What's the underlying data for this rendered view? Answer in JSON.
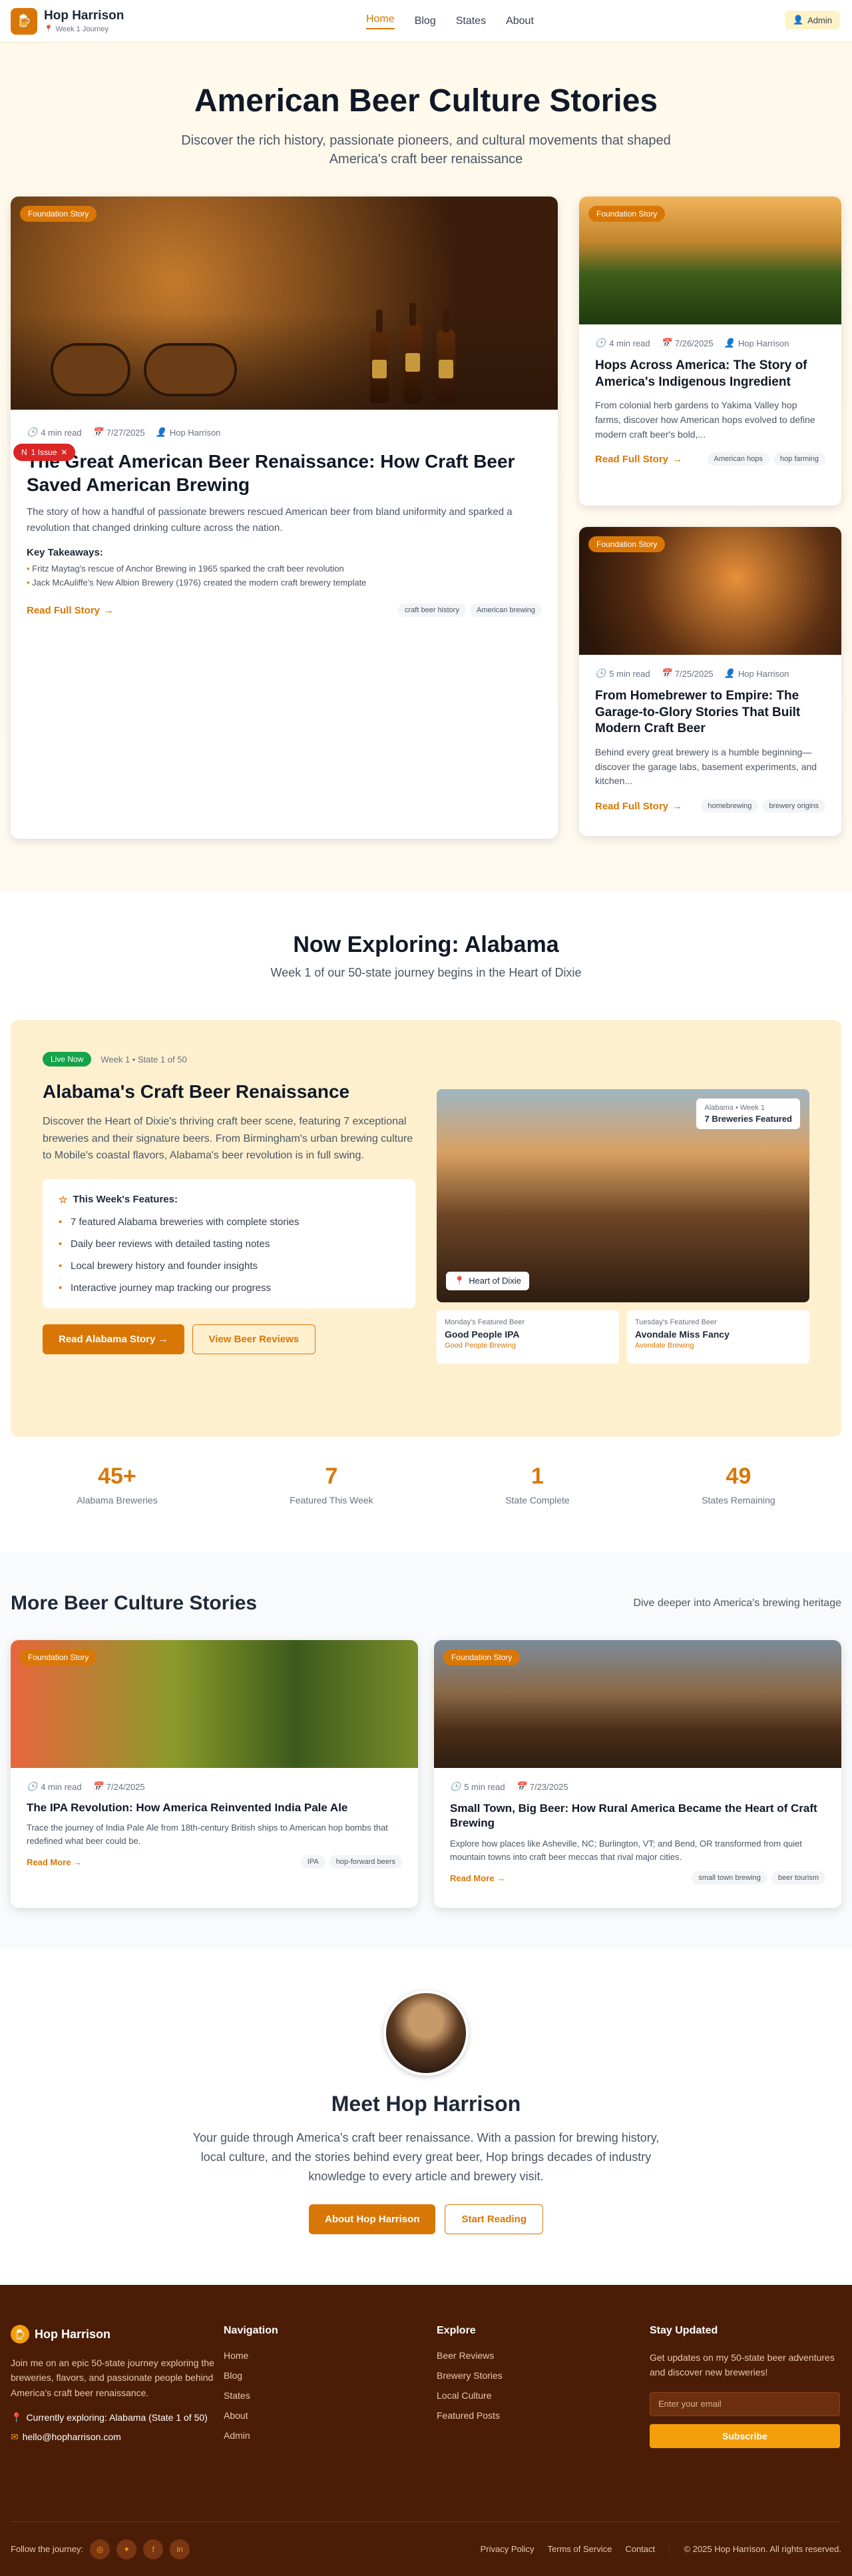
{
  "header": {
    "brand": "Hop Harrison",
    "subtitle": "Week 1 Journey",
    "nav": [
      "Home",
      "Blog",
      "States",
      "About"
    ],
    "admin": "Admin"
  },
  "hero": {
    "title": "American Beer Culture Stories",
    "subtitle": "Discover the rich history, passionate pioneers, and cultural movements that shaped America's craft beer renaissance"
  },
  "featured": {
    "tag": "Foundation Story",
    "read": "4 min read",
    "date": "7/27/2025",
    "author": "Hop Harrison",
    "title": "The Great American Beer Renaissance: How Craft Beer Saved American Brewing",
    "excerpt": "The story of how a handful of passionate brewers rescued American beer from bland uniformity and sparked a revolution that changed drinking culture across the nation.",
    "takeaways_label": "Key Takeaways:",
    "takeaways": [
      "Fritz Maytag's rescue of Anchor Brewing in 1965 sparked the craft beer revolution",
      "Jack McAuliffe's New Albion Brewery (1976) created the modern craft brewery template"
    ],
    "cta": "Read Full Story",
    "chips": [
      "craft beer history",
      "American brewing"
    ]
  },
  "side": [
    {
      "tag": "Foundation Story",
      "read": "4 min read",
      "date": "7/26/2025",
      "author": "Hop Harrison",
      "title": "Hops Across America: The Story of America's Indigenous Ingredient",
      "excerpt": "From colonial herb gardens to Yakima Valley hop farms, discover how American hops evolved to define modern craft beer's bold,...",
      "cta": "Read Full Story",
      "chips": [
        "American hops",
        "hop farming"
      ]
    },
    {
      "tag": "Foundation Story",
      "read": "5 min read",
      "date": "7/25/2025",
      "author": "Hop Harrison",
      "title": "From Homebrewer to Empire: The Garage-to-Glory Stories That Built Modern Craft Beer",
      "excerpt": "Behind every great brewery is a humble beginning—discover the garage labs, basement experiments, and kitchen...",
      "cta": "Read Full Story",
      "chips": [
        "homebrewing",
        "brewery origins"
      ]
    }
  ],
  "issue": "1 Issue",
  "explore": {
    "title": "Now Exploring: Alabama",
    "subtitle": "Week 1 of our 50-state journey begins in the Heart of Dixie",
    "live": "Live Now",
    "week": "Week 1 • State 1 of 50",
    "heading": "Alabama's Craft Beer Renaissance",
    "desc": "Discover the Heart of Dixie's thriving craft beer scene, featuring 7 exceptional breweries and their signature beers. From Birmingham's urban brewing culture to Mobile's coastal flavors, Alabama's beer revolution is in full swing.",
    "features_label": "This Week's Features:",
    "features": [
      "7 featured Alabama breweries with complete stories",
      "Daily beer reviews with detailed tasting notes",
      "Local brewery history and founder insights",
      "Interactive journey map tracking our progress"
    ],
    "btn1": "Read Alabama Story",
    "btn2": "View Beer Reviews",
    "img_badge_top": "Alabama • Week 1",
    "img_badge_main": "7 Breweries Featured",
    "img_loc": "Heart of Dixie",
    "mini": [
      {
        "label": "Monday's Featured Beer",
        "name": "Good People IPA",
        "brewery": "Good People Brewing"
      },
      {
        "label": "Tuesday's Featured Beer",
        "name": "Avondale Miss Fancy",
        "brewery": "Avondale Brewing"
      }
    ]
  },
  "stats": [
    {
      "n": "45+",
      "l": "Alabama Breweries"
    },
    {
      "n": "7",
      "l": "Featured This Week"
    },
    {
      "n": "1",
      "l": "State Complete"
    },
    {
      "n": "49",
      "l": "States Remaining"
    }
  ],
  "more": {
    "title": "More Beer Culture Stories",
    "right": "Dive deeper into America's brewing heritage",
    "cards": [
      {
        "tag": "Foundation Story",
        "read": "4 min read",
        "date": "7/24/2025",
        "title": "The IPA Revolution: How America Reinvented India Pale Ale",
        "excerpt": "Trace the journey of India Pale Ale from 18th-century British ships to American hop bombs that redefined what beer could be.",
        "cta": "Read More →",
        "chips": [
          "IPA",
          "hop-forward beers"
        ]
      },
      {
        "tag": "Foundation Story",
        "read": "5 min read",
        "date": "7/23/2025",
        "title": "Small Town, Big Beer: How Rural America Became the Heart of Craft Brewing",
        "excerpt": "Explore how places like Asheville, NC; Burlington, VT; and Bend, OR transformed from quiet mountain towns into craft beer meccas that rival major cities.",
        "cta": "Read More →",
        "chips": [
          "small town brewing",
          "beer tourism"
        ]
      }
    ]
  },
  "author": {
    "title": "Meet Hop Harrison",
    "bio": "Your guide through America's craft beer renaissance. With a passion for brewing history, local culture, and the stories behind every great beer, Hop brings decades of industry knowledge to every article and brewery visit.",
    "btn1": "About Hop Harrison",
    "btn2": "Start Reading"
  },
  "footer": {
    "brand": "Hop Harrison",
    "about": "Join me on an epic 50-state journey exploring the breweries, flavors, and passionate people behind America's craft beer renaissance.",
    "current": "Currently exploring: Alabama (State 1 of 50)",
    "email": "hello@hopharrison.com",
    "nav_title": "Navigation",
    "nav": [
      "Home",
      "Blog",
      "States",
      "About",
      "Admin"
    ],
    "explore_title": "Explore",
    "explore": [
      "Beer Reviews",
      "Brewery Stories",
      "Local Culture",
      "Featured Posts"
    ],
    "updated_title": "Stay Updated",
    "updated_desc": "Get updates on my 50-state beer adventures and discover new breweries!",
    "email_placeholder": "Enter your email",
    "subscribe": "Subscribe",
    "follow": "Follow the journey:",
    "legal": [
      "Privacy Policy",
      "Terms of Service",
      "Contact"
    ],
    "copyright": "© 2025 Hop Harrison. All rights reserved."
  }
}
